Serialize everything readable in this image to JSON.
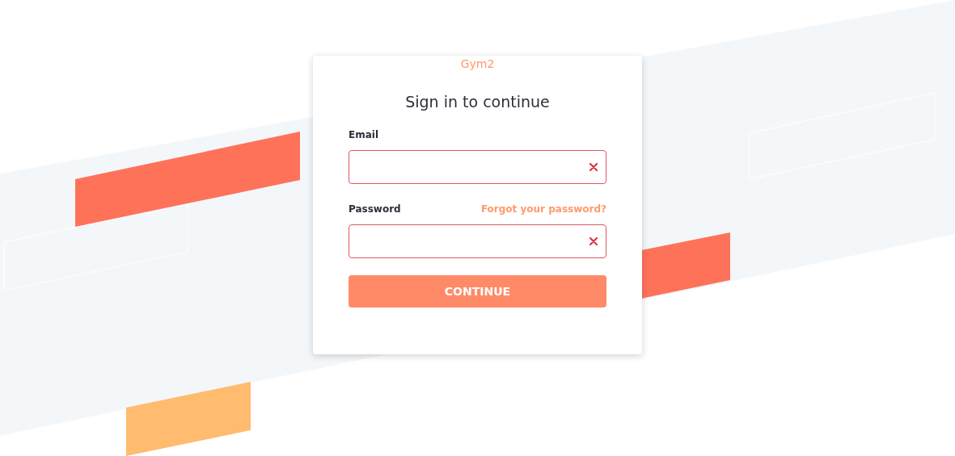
{
  "brand": "Gym2",
  "heading": "Sign in to continue",
  "fields": [
    {
      "label": "Email",
      "invalid": true
    },
    {
      "label": "Password",
      "invalid": true,
      "link": "Forgot your password?"
    }
  ],
  "submit": "CONTINUE"
}
